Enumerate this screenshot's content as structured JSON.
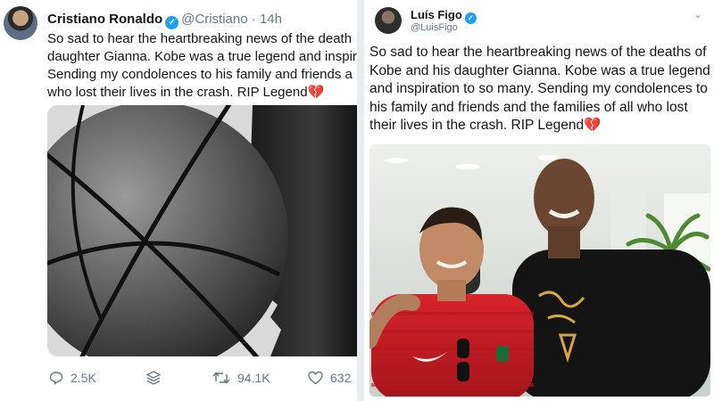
{
  "left_tweet": {
    "author_name": "Cristiano Ronaldo",
    "handle": "@Cristiano",
    "separator": "·",
    "time": "14h",
    "text_lines": [
      "So sad to hear the heartbreaking news of the death",
      "daughter Gianna. Kobe was a true legend and inspir",
      "Sending my condolences to his family and friends a",
      "who lost their lives in the crash. RIP Legend"
    ],
    "broken_heart_emoji": "💔",
    "actions": {
      "reply_count": "2.5K",
      "retweet_count": "94.1K",
      "like_count": "632"
    }
  },
  "right_tweet": {
    "author_name": "Luís Figo",
    "handle": "@LuisFigo",
    "text_lines": [
      "So sad to hear the heartbreaking news of the deaths of",
      "Kobe and his daughter Gianna. Kobe was a true legend",
      "and inspiration to so many. Sending my condolences to",
      "his family and friends and the families of all who lost",
      "their lives in the crash. RIP Legend"
    ],
    "broken_heart_emoji": "💔"
  },
  "colors": {
    "verified_blue": "#1da1f2",
    "muted_text": "#657786",
    "body_text": "#14171a",
    "heart_red": "#d63a4a"
  },
  "icons": {
    "verified": "verified-badge-icon",
    "reply": "reply-icon",
    "share": "share-stack-icon",
    "retweet": "retweet-icon",
    "like": "heart-icon",
    "more": "chevron-down-icon"
  }
}
